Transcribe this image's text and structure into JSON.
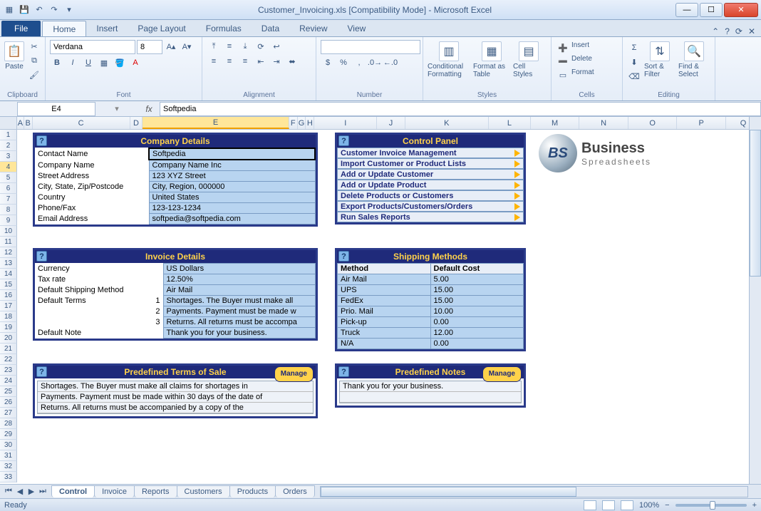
{
  "window": {
    "title": "Customer_Invoicing.xls  [Compatibility Mode] - Microsoft Excel"
  },
  "tabs": {
    "file": "File",
    "home": "Home",
    "insert": "Insert",
    "pagelayout": "Page Layout",
    "formulas": "Formulas",
    "data": "Data",
    "review": "Review",
    "view": "View"
  },
  "ribbon": {
    "clipboard": "Clipboard",
    "paste": "Paste",
    "font_group": "Font",
    "font": "Verdana",
    "size": "8",
    "alignment": "Alignment",
    "number": "Number",
    "styles": "Styles",
    "cf": "Conditional Formatting",
    "fat": "Format as Table",
    "cs": "Cell Styles",
    "cells": "Cells",
    "insertc": "Insert",
    "deletec": "Delete",
    "formatc": "Format",
    "editing": "Editing",
    "sort": "Sort & Filter",
    "find": "Find & Select"
  },
  "formula": {
    "cell": "E4",
    "fx": "fx",
    "value": "Softpedia"
  },
  "cols": [
    "A",
    "B",
    "C",
    "D",
    "E",
    "F",
    "G",
    "H",
    "I",
    "J",
    "K",
    "L",
    "M",
    "N",
    "O",
    "P",
    "Q"
  ],
  "company": {
    "title": "Company Details",
    "rows": [
      {
        "label": "Contact Name",
        "value": "Softpedia"
      },
      {
        "label": "Company Name",
        "value": "Company Name Inc"
      },
      {
        "label": "Street Address",
        "value": "123 XYZ Street"
      },
      {
        "label": "City, State, Zip/Postcode",
        "value": "City, Region, 000000"
      },
      {
        "label": "Country",
        "value": "United States"
      },
      {
        "label": "Phone/Fax",
        "value": "123-123-1234"
      },
      {
        "label": "Email Address",
        "value": "softpedia@softpedia.com"
      }
    ]
  },
  "control": {
    "title": "Control Panel",
    "items": [
      "Customer Invoice Management",
      "Import Customer or Product Lists",
      "Add or Update Customer",
      "Add or Update Product",
      "Delete Products or Customers",
      "Export Products/Customers/Orders",
      "Run Sales Reports"
    ]
  },
  "invoice": {
    "title": "Invoice Details",
    "currency_l": "Currency",
    "currency": "US Dollars",
    "tax_l": "Tax rate",
    "tax": "12.50%",
    "ship_l": "Default Shipping Method",
    "ship": "Air Mail",
    "terms_l": "Default Terms",
    "term1_n": "1",
    "term1": "Shortages. The Buyer must make all",
    "term2_n": "2",
    "term2": "Payments. Payment must be made w",
    "term3_n": "3",
    "term3": "Returns. All returns must be accompa",
    "note_l": "Default Note",
    "note": "Thank you for your business."
  },
  "shipping": {
    "title": "Shipping Methods",
    "h1": "Method",
    "h2": "Default Cost",
    "rows": [
      {
        "m": "Air Mail",
        "c": "5.00"
      },
      {
        "m": "UPS",
        "c": "15.00"
      },
      {
        "m": "FedEx",
        "c": "15.00"
      },
      {
        "m": "Prio. Mail",
        "c": "10.00"
      },
      {
        "m": "Pick-up",
        "c": "0.00"
      },
      {
        "m": "Truck",
        "c": "12.00"
      },
      {
        "m": "N/A",
        "c": "0.00"
      }
    ]
  },
  "terms_panel": {
    "title": "Predefined Terms of Sale",
    "manage": "Manage",
    "lines": [
      "Shortages. The Buyer must make all claims for shortages in",
      "Payments. Payment must be made within 30 days of the date of",
      "Returns. All returns must be accompanied by a copy of the"
    ]
  },
  "notes_panel": {
    "title": "Predefined Notes",
    "manage": "Manage",
    "lines": [
      "Thank you for your business.",
      ""
    ]
  },
  "logo": {
    "abbr": "BS",
    "line1": "Business",
    "line2": "Spreadsheets"
  },
  "sheets": [
    "Control",
    "Invoice",
    "Reports",
    "Customers",
    "Products",
    "Orders"
  ],
  "status": {
    "ready": "Ready",
    "zoom": "100%"
  }
}
